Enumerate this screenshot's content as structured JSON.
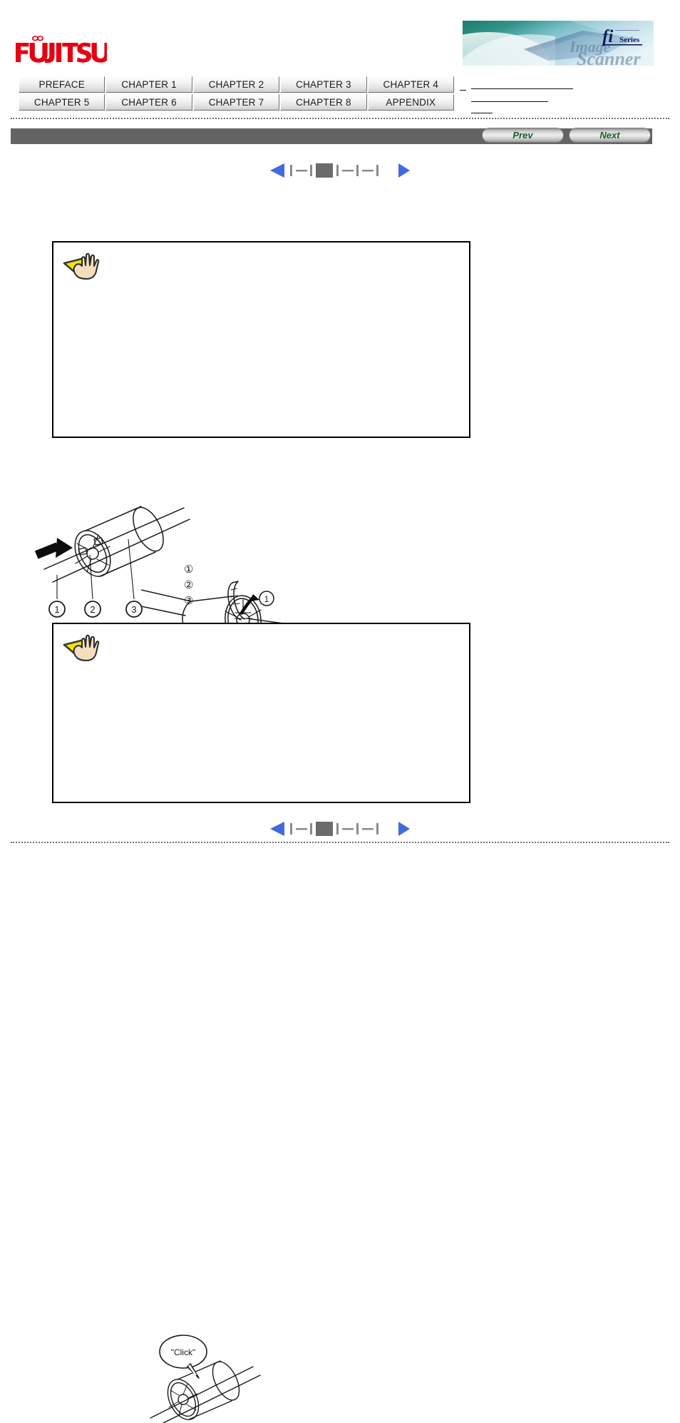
{
  "header": {
    "logo_text": "FUJITSU",
    "logo_color": "#e60012",
    "banner": {
      "brand": "fi",
      "series": "Series",
      "subtitle_1": "Image",
      "subtitle_2": "Scanner",
      "gradient_from": "#1f7a6e",
      "gradient_to": "#e8f4f8"
    },
    "rules": [
      "",
      "",
      ""
    ]
  },
  "tabs": {
    "row1": [
      {
        "label": "PREFACE"
      },
      {
        "label": "CHAPTER 1"
      },
      {
        "label": "CHAPTER 2"
      },
      {
        "label": "CHAPTER 3"
      },
      {
        "label": "CHAPTER 4"
      }
    ],
    "row2": [
      {
        "label": "CHAPTER 5"
      },
      {
        "label": "CHAPTER 6"
      },
      {
        "label": "CHAPTER 7"
      },
      {
        "label": "CHAPTER 8"
      },
      {
        "label": "APPENDIX"
      }
    ]
  },
  "toolbar": {
    "prev_label": "Prev",
    "next_label": "Next",
    "bar_color": "#636363",
    "label_color": "#1e5c27"
  },
  "pager": {
    "prev_arrow": "prev-triangle",
    "next_arrow": "next-triangle",
    "current_index": 1,
    "accent_color": "#4169e1",
    "marker_color": "#6b6b6b",
    "steps": [
      "tick",
      "dash",
      "tick",
      "current",
      "tick",
      "dash",
      "tick",
      "dash",
      "tick"
    ]
  },
  "notes": [
    {
      "icon": "caution-hand-icon",
      "text": "",
      "figure": "pick-roller-removal-diagram",
      "figure_callouts": [
        "①",
        "②"
      ]
    },
    {
      "icon": "caution-hand-icon",
      "text": "",
      "figure": "pick-roller-click-diagram",
      "figure_callouts": [
        "\"Click\""
      ]
    }
  ],
  "figures": {
    "assembly": {
      "name": "pick-roller-assembly-diagram",
      "callouts": [
        "①",
        "②",
        "③"
      ]
    },
    "click_bubble": "\"Click\""
  },
  "legend": {
    "items": [
      {
        "mark": "①",
        "label": ""
      },
      {
        "mark": "②",
        "label": ""
      },
      {
        "mark": "③",
        "label": ""
      }
    ]
  }
}
